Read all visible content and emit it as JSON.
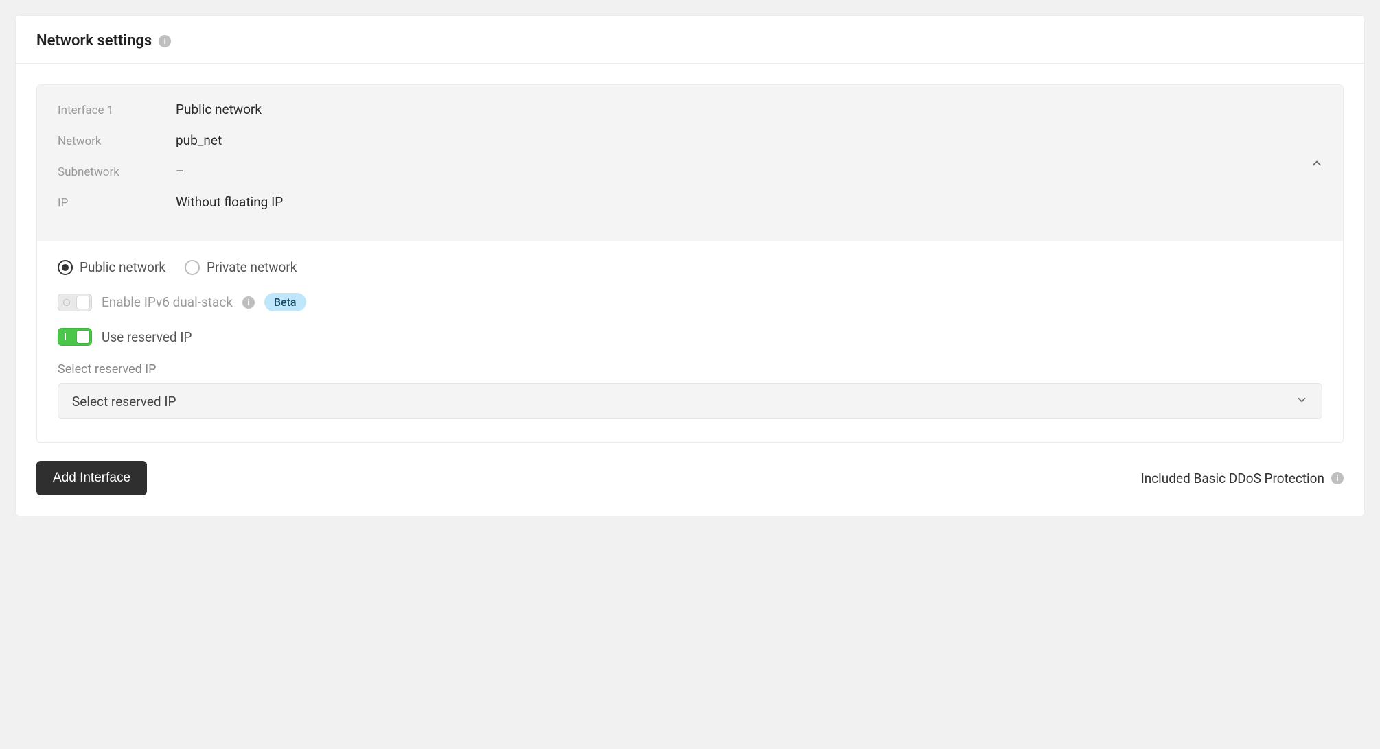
{
  "header": {
    "title": "Network settings"
  },
  "summary": {
    "rows": [
      {
        "label": "Interface 1",
        "value": "Public network"
      },
      {
        "label": "Network",
        "value": "pub_net"
      },
      {
        "label": "Subnetwork",
        "value": "–"
      },
      {
        "label": "IP",
        "value": "Without floating IP"
      }
    ]
  },
  "details": {
    "network_type": {
      "public_label": "Public network",
      "private_label": "Private network",
      "selected": "public"
    },
    "ipv6": {
      "label": "Enable IPv6 dual-stack",
      "enabled": false,
      "badge": "Beta"
    },
    "reserved_ip": {
      "label": "Use reserved IP",
      "enabled": true
    },
    "select": {
      "label": "Select reserved IP",
      "placeholder": "Select reserved IP"
    }
  },
  "footer": {
    "add_interface": "Add Interface",
    "ddos": "Included Basic DDoS Protection"
  }
}
